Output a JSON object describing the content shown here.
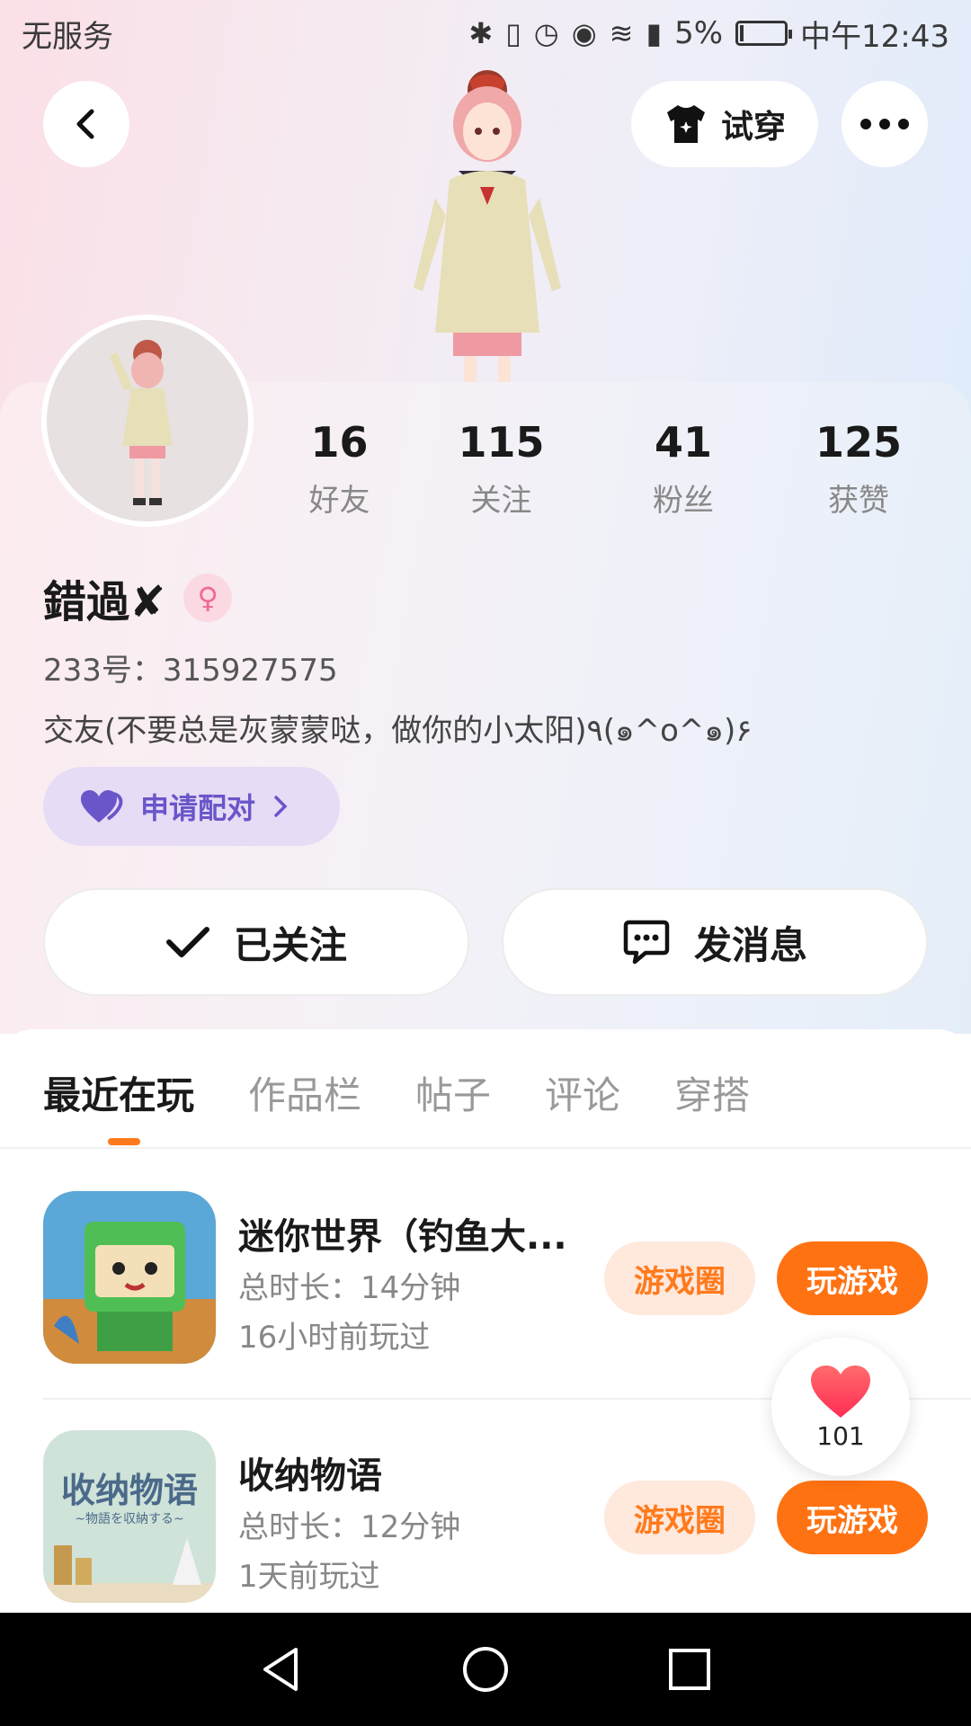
{
  "status_bar": {
    "carrier": "无服务",
    "battery": "5%",
    "time": "中午12:43"
  },
  "header": {
    "try_on_label": "试穿"
  },
  "profile": {
    "stats": [
      {
        "value": "16",
        "label": "好友"
      },
      {
        "value": "115",
        "label": "关注"
      },
      {
        "value": "41",
        "label": "粉丝"
      },
      {
        "value": "125",
        "label": "获赞"
      }
    ],
    "name": "錯過✘",
    "uid": "233号：315927575",
    "bio": "交友(不要总是灰蒙蒙哒，做你的小太阳)٩(๑^o^๑)۶",
    "pair_label": "申请配对"
  },
  "actions": {
    "follow_label": "已关注",
    "message_label": "发消息"
  },
  "tabs": [
    "最近在玩",
    "作品栏",
    "帖子",
    "评论",
    "穿搭"
  ],
  "games": [
    {
      "title": "迷你世界（钓鱼大...",
      "duration": "总时长：14分钟",
      "last_played": "16小时前玩过",
      "circle_label": "游戏圈",
      "play_label": "玩游戏"
    },
    {
      "title": "收纳物语",
      "duration": "总时长：12分钟",
      "last_played": "1天前玩过",
      "circle_label": "游戏圈",
      "play_label": "玩游戏",
      "icon_text": "收纳物语",
      "icon_sub": "~物語を収納する~"
    }
  ],
  "like_count": "101",
  "colors": {
    "accent": "#ff7212",
    "pair_bg": "#e6dcf6",
    "pair_text": "#6a55c9"
  }
}
